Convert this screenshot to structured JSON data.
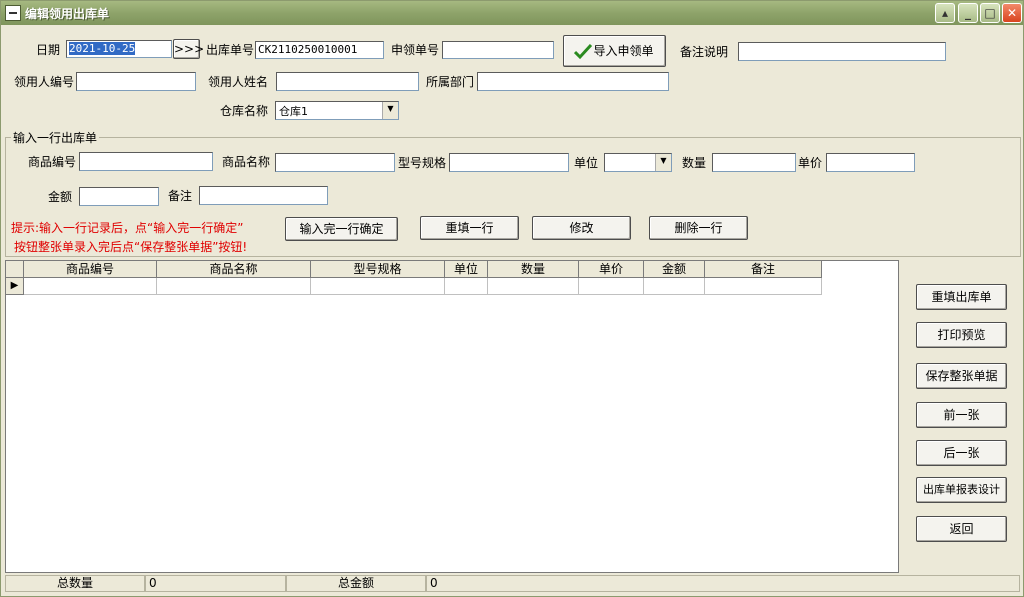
{
  "window": {
    "title": "编辑领用出库单"
  },
  "form": {
    "date_label": "日期",
    "date_value": "2021-10-25",
    "date_picker": ">>>",
    "out_no_label": "出库单号",
    "out_no_value": "CK2110250010001",
    "apply_no_label": "申领单号",
    "apply_no_value": "",
    "import_btn": "导入申领单",
    "remark_label": "备注说明",
    "remark_value": "",
    "user_id_label": "领用人编号",
    "user_id_value": "",
    "user_name_label": "领用人姓名",
    "user_name_value": "",
    "dept_label": "所属部门",
    "dept_value": "",
    "warehouse_label": "仓库名称",
    "warehouse_value": "仓库1"
  },
  "line_entry": {
    "group_label": "输入一行出库单",
    "code_label": "商品编号",
    "name_label": "商品名称",
    "spec_label": "型号规格",
    "unit_label": "单位",
    "qty_label": "数量",
    "price_label": "单价",
    "amount_label": "金额",
    "note_label": "备注",
    "hint_line1": "提示:输入一行记录后，点“输入完一行确定”",
    "hint_line2": "按钮整张单录入完后点“保存整张单据”按钮!",
    "btn_confirm": "输入完一行确定",
    "btn_refill": "重填一行",
    "btn_modify": "修改",
    "btn_delete": "删除一行"
  },
  "grid": {
    "columns": [
      "商品编号",
      "商品名称",
      "型号规格",
      "单位",
      "数量",
      "单价",
      "金额",
      "备注"
    ],
    "row_indicator": "▶"
  },
  "side_buttons": {
    "refill_order": "重填出库单",
    "print_preview": "打印预览",
    "save_order": "保存整张单据",
    "prev": "前一张",
    "next": "后一张",
    "report_design": "出库单报表设计",
    "back": "返回"
  },
  "status": {
    "total_qty_label": "总数量",
    "total_qty_value": "0",
    "total_amount_label": "总金额",
    "total_amount_value": "0"
  },
  "colors": {
    "title_bar": "#8ea36a",
    "hint_text": "#e00000",
    "date_selection": "#316ac5",
    "check_mark": "#2a8a1f"
  }
}
